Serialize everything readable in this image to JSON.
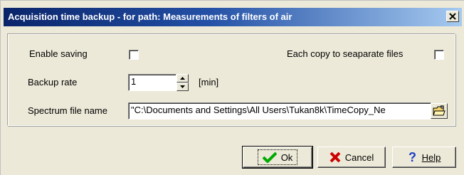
{
  "window": {
    "title": "Acquisition time backup - for path: Measurements of filters of air"
  },
  "form": {
    "enable_saving_label": "Enable saving",
    "enable_saving_checked": false,
    "each_copy_label": "Each copy to seaparate files",
    "each_copy_checked": false,
    "backup_rate_label": "Backup rate",
    "backup_rate_value": "1",
    "backup_rate_unit": "[min]",
    "spectrum_file_label": "Spectrum file name",
    "spectrum_file_value": "\"C:\\Documents and Settings\\All Users\\Tukan8k\\TimeCopy_Ne"
  },
  "buttons": {
    "ok_label": "Ok",
    "cancel_label": "Cancel",
    "help_label": "Help"
  },
  "icons": {
    "close": "close-icon",
    "spin_up": "chevron-up-icon",
    "spin_down": "chevron-down-icon",
    "browse": "open-folder-icon",
    "ok": "checkmark-icon",
    "cancel": "x-icon",
    "help": "question-mark-icon"
  },
  "colors": {
    "titlebar_start": "#0a246a",
    "titlebar_end": "#a6caf0",
    "dialog_bg": "#ece9d8",
    "ok_check": "#00aa00",
    "cancel_x": "#cc0000",
    "help_q": "#1a3fc9"
  }
}
